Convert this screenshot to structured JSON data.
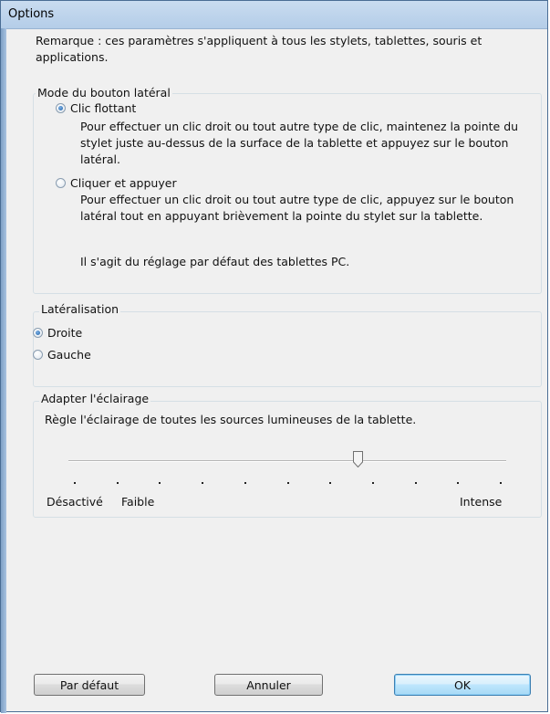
{
  "window": {
    "title": "Options"
  },
  "note": "Remarque : ces paramètres s'appliquent à tous les stylets, tablettes, souris et applications.",
  "side_button_mode": {
    "legend": "Mode du bouton latéral",
    "options": [
      {
        "label": "Clic flottant",
        "checked": true,
        "description": "Pour effectuer un clic droit ou tout autre type de clic, maintenez la pointe du stylet juste au-dessus de la surface de la tablette et appuyez sur le bouton latéral."
      },
      {
        "label": "Cliquer et appuyer",
        "checked": false,
        "description": "Pour effectuer un clic droit ou tout autre type de clic, appuyez sur le bouton latéral tout en appuyant brièvement la pointe du stylet sur la tablette."
      }
    ],
    "default_note": "Il s'agit du réglage par défaut des tablettes PC."
  },
  "handedness": {
    "legend": "Latéralisation",
    "options": [
      {
        "label": "Droite",
        "checked": true
      },
      {
        "label": "Gauche",
        "checked": false
      }
    ]
  },
  "lighting": {
    "legend": "Adapter l'éclairage",
    "description": "Règle l'éclairage de toutes les sources lumineuses de la tablette.",
    "slider": {
      "steps": 10,
      "position": 6,
      "fraction": 0.667
    },
    "labels": {
      "off": "Désactivé",
      "low": "Faible",
      "high": "Intense"
    }
  },
  "buttons": {
    "default": "Par défaut",
    "cancel": "Annuler",
    "ok": "OK"
  },
  "colors": {
    "title_bar": "#b9d1ea",
    "window_bg": "#f0f0f0",
    "ok_button": "#bee6fd"
  }
}
